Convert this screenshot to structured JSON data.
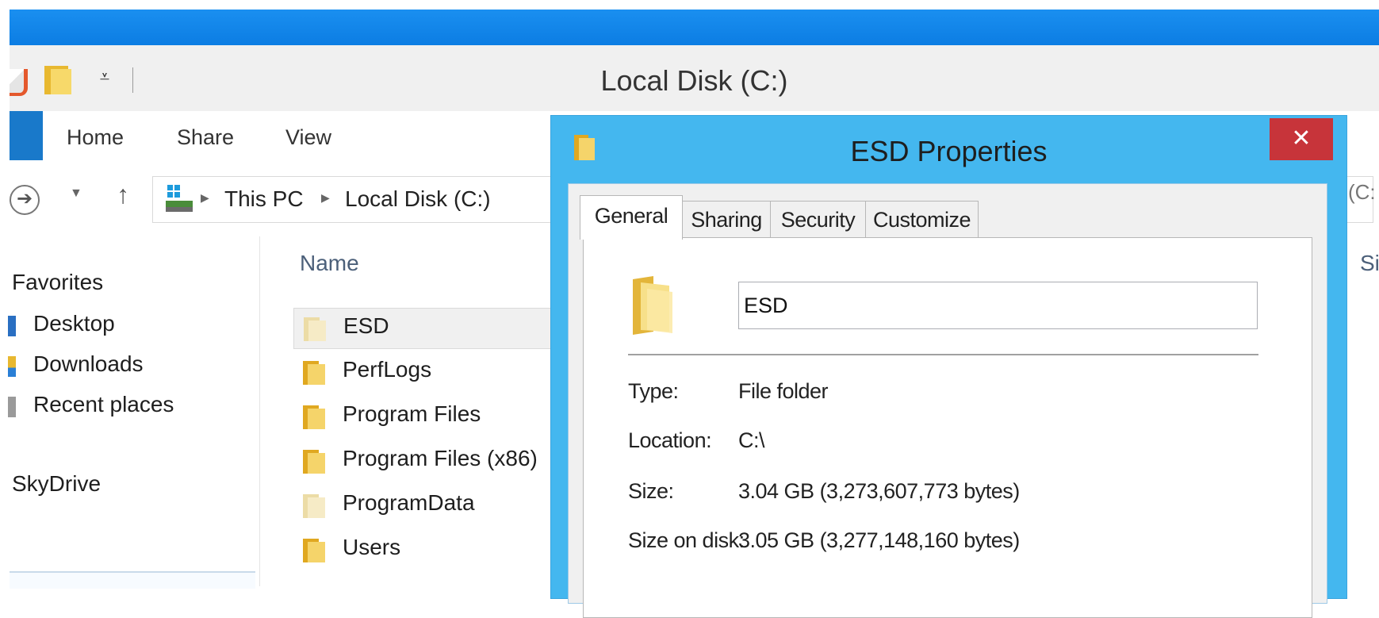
{
  "window": {
    "title": "Local Disk (C:)",
    "ribbon_tabs": [
      "Home",
      "Share",
      "View"
    ]
  },
  "address_bar": {
    "crumbs": [
      "This PC",
      "Local Disk (C:)"
    ],
    "search_fragment": "(C:"
  },
  "nav_pane": {
    "favorites_header": "Favorites",
    "items": [
      "Desktop",
      "Downloads",
      "Recent places"
    ],
    "skydrive": "SkyDrive"
  },
  "file_list": {
    "columns": {
      "name": "Name",
      "size": "Si"
    },
    "rows": [
      {
        "name": "ESD",
        "selected": true
      },
      {
        "name": "PerfLogs",
        "selected": false
      },
      {
        "name": "Program Files",
        "selected": false
      },
      {
        "name": "Program Files (x86)",
        "selected": false
      },
      {
        "name": "ProgramData",
        "selected": false
      },
      {
        "name": "Users",
        "selected": false
      }
    ]
  },
  "dialog": {
    "title": "ESD Properties",
    "close_glyph": "✕",
    "tabs": [
      "General",
      "Sharing",
      "Security",
      "Customize"
    ],
    "active_tab": "General",
    "folder_name": "ESD",
    "properties": [
      {
        "label": "Type:",
        "value": "File folder"
      },
      {
        "label": "Location:",
        "value": "C:\\"
      },
      {
        "label": "Size:",
        "value": "3.04 GB (3,273,607,773 bytes)"
      },
      {
        "label": "Size on disk:",
        "value": "3.05 GB (3,277,148,160 bytes)"
      }
    ]
  },
  "colors": {
    "titlebar_blue": "#0c7de3",
    "dialog_border": "#44b7ef",
    "close_red": "#c7343a",
    "file_tab_blue": "#1979ca"
  }
}
